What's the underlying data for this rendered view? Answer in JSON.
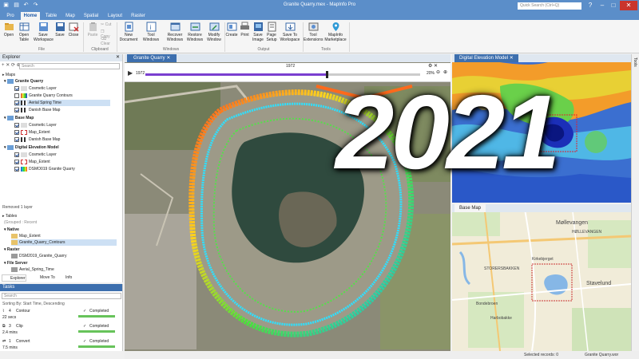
{
  "window": {
    "title": "Granite Quarry.mex - MapInfo Pro",
    "search_placeholder": "Quick Search (Ctrl+Q)"
  },
  "menu_tabs": [
    "Pro",
    "Home",
    "Table",
    "Map",
    "Spatial",
    "Layout",
    "Raster"
  ],
  "active_tab": "Home",
  "ribbon": {
    "file": {
      "open": "Open",
      "open_table": "Open Table",
      "save_workspace": "Save Workspace",
      "save": "Save",
      "close": "Close",
      "group": "File"
    },
    "clipboard": {
      "paste": "Paste",
      "cut": "Cut",
      "copy": "Copy",
      "clear": "Clear",
      "group": "Clipboard"
    },
    "windows": {
      "new_document": "New Document",
      "tool_windows": "Tool Windows",
      "recover": "Recover Windows",
      "restore": "Restore Windows",
      "modify": "Modify Window",
      "group": "Windows"
    },
    "output": {
      "create": "Create",
      "print": "Print",
      "save_image": "Save Image",
      "page_setup": "Page Setup",
      "save_to_workspace": "Save To Workspace",
      "group": "Output"
    },
    "tools": {
      "tool_extensions": "Tool Extensions",
      "mapinfo_marketplace": "MapInfo Marketplace",
      "group": "Tools"
    }
  },
  "explorer": {
    "title": "Explorer",
    "search_placeholder": "Search",
    "maps_label": "Maps",
    "granite_quarry": {
      "name": "Granite Quarry",
      "layers": [
        "Cosmetic Layer",
        "Granite Quarry Contours",
        "Aerial Spring Time",
        "Danish Base Map"
      ]
    },
    "base_map": {
      "name": "Base Map",
      "layers": [
        "Cosmetic Layer",
        "Map_Extent",
        "Danish Base Map"
      ]
    },
    "dem": {
      "name": "Digital Elevation Model",
      "layers": [
        "Cosmetic Layer",
        "Map_Extent",
        "DSMO019 Granite Quarry"
      ]
    },
    "removed_text": "Removed 1 layer",
    "tables_label": "Tables",
    "grouped_label": "(Grouped : Recent",
    "native": {
      "name": "Native",
      "items": [
        "Map_Extent",
        "Granite_Quarry_Contours"
      ]
    },
    "raster": {
      "name": "Raster",
      "items": [
        "DSM2019_Granite_Quarry"
      ]
    },
    "file_server": {
      "name": "File Server",
      "items": [
        "Aerial_Spring_Time"
      ]
    },
    "bottom_tabs": [
      "Explorer",
      "Move To",
      "Info"
    ]
  },
  "tasks": {
    "title": "Tasks",
    "search_placeholder": "Search",
    "sort_label": "Sorting By: Start Time, Descending",
    "items": [
      {
        "index": "4",
        "name": "Contour",
        "duration": "22 secs",
        "status": "Completed"
      },
      {
        "index": "3",
        "name": "Clip",
        "duration": "2.4 mins",
        "status": "Completed"
      },
      {
        "index": "1",
        "name": "Convert",
        "duration": "7.5 mins",
        "status": "Completed"
      }
    ]
  },
  "views": {
    "granite_quarry_tab": "Granite Quarry",
    "dem_tab": "Digital Elevation Model",
    "base_map_tab": "Base Map",
    "timeline_year": "1972",
    "timeline_start": "1972",
    "timeline_zoom": "20%",
    "timeline_progress": 0.66,
    "overlay_year": "2021"
  },
  "base_map_labels": [
    "Møllevangen",
    "HØLLEVANGEN",
    "Kirkebjerget",
    "STORERSBAKKEN",
    "Stavelund",
    "Bondebroen",
    "Harbobakke"
  ],
  "status": {
    "selected": "Selected records: 0",
    "workspace": "Granite Quarry.wor"
  },
  "colors": {
    "titlebar": "#5b8ec9",
    "accent": "#1e5aa8",
    "timeline": "#7a3fd0",
    "completed": "#67c35a"
  }
}
